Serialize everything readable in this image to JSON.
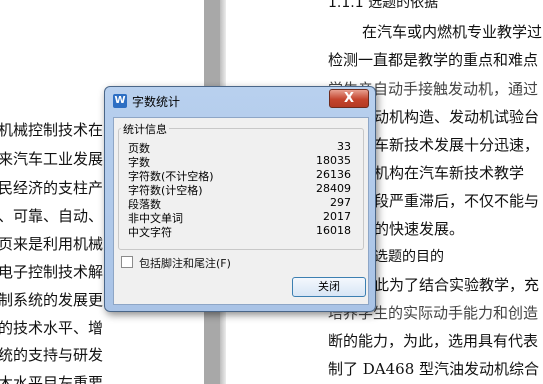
{
  "document": {
    "left_page_lines": [
      "机械控制技术在",
      "来汽车工业发展",
      "民经济的支柱产",
      "、可靠、自动、",
      "页来是利用机械",
      "电子控制技术解",
      "制系统的发展更",
      "的技术水平、增",
      "统的支持与研发",
      "木水平目左重要"
    ],
    "right_page_lines": [
      "1.1.1  选题的依据",
      "在汽车或内燃机专业教学过",
      "检测一直都是教学的重点和难点",
      "学生亲自动手接触发动机，通过",
      "动机构造、发动机试验台",
      "车新技术发展十分迅速，",
      "机构在汽车新技术教学",
      "段严重滞后，不仅不能与",
      "的快速发展。",
      "选题的目的",
      "此为了结合实验教学，充",
      "培养学生的实际动手能力和创造",
      "断的能力，为此，选用具有代表",
      "制了 DA468 型汽油发动机综合"
    ]
  },
  "dialog": {
    "title": "字数统计",
    "app_icon_glyph": "W",
    "close_x": "X",
    "group_title": "统计信息",
    "stats": [
      {
        "label": "页数",
        "value": "33"
      },
      {
        "label": "字数",
        "value": "18035"
      },
      {
        "label": "字符数(不计空格)",
        "value": "26136"
      },
      {
        "label": "字符数(计空格)",
        "value": "28409"
      },
      {
        "label": "段落数",
        "value": "297"
      },
      {
        "label": "非中文单词",
        "value": "2017"
      },
      {
        "label": "中文字符",
        "value": "16018"
      }
    ],
    "checkbox_label": "包括脚注和尾注(F)",
    "checkbox_checked": false,
    "close_button": "关闭"
  },
  "colors": {
    "titlebar": "#b8d0ee",
    "close_red": "#c4452e",
    "button_border": "#3c7fb1"
  }
}
